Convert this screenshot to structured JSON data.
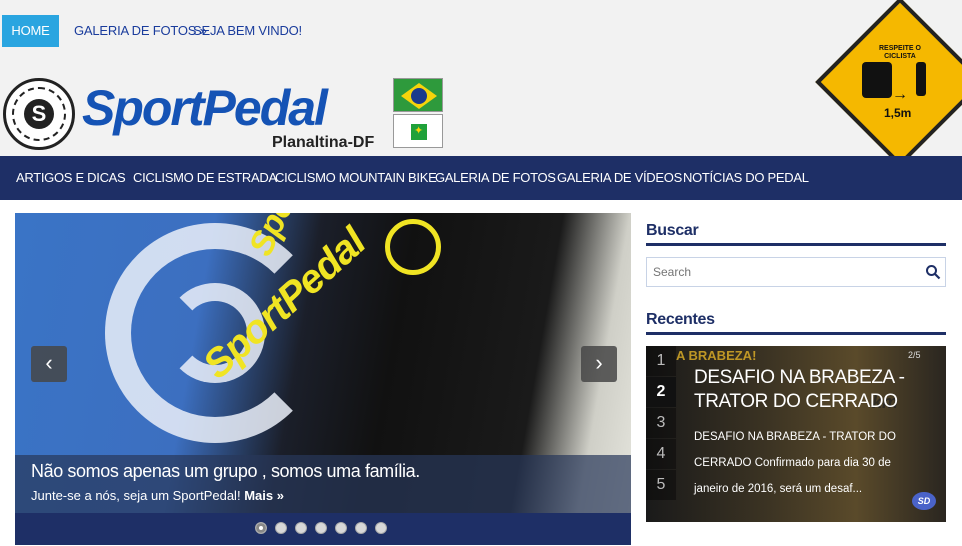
{
  "topnav": {
    "items": [
      "HOME",
      "GALERIA DE FOTOS »",
      "SEJA BEM VINDO!"
    ]
  },
  "header": {
    "logo_text": "SportPedal",
    "logo_sub": "Planaltina-DF",
    "sign_text": "RESPEITE O CICLISTA",
    "sign_distance": "1,5m"
  },
  "mainnav": {
    "items": [
      "ARTIGOS E DICAS",
      "CICLISMO DE ESTRADA",
      "CICLISMO MOUNTAIN BIKE",
      "GALERIA DE FOTOS",
      "GALERIA DE VÍDEOS",
      "NOTÍCIAS DO PEDAL"
    ]
  },
  "slider": {
    "jersey_text": "SportPedal",
    "caption_title": "Não somos apenas um grupo , somos uma família.",
    "caption_text": "Junte-se a nós, seja um SportPedal!",
    "caption_more": "Mais »",
    "prev_icon": "chevron-left-icon",
    "next_icon": "chevron-right-icon",
    "dots": 7,
    "active_dot": 1
  },
  "sidebar": {
    "search_title": "Buscar",
    "search_placeholder": "Search",
    "recent_title": "Recentes",
    "recent": {
      "numbers": [
        "1",
        "2",
        "3",
        "4",
        "5"
      ],
      "active": 2,
      "counter": "2/5",
      "banner": "A BRABEZA!",
      "title": "DESAFIO NA BRABEZA - TRATOR DO CERRADO",
      "text": "DESAFIO NA BRABEZA - TRATOR DO CERRADO Confirmado para dia 30 de janeiro de 2016, será um desaf...",
      "logo": "SD"
    }
  },
  "colors": {
    "nav_dark": "#1e2f66",
    "home_active": "#2aa5e0",
    "link_blue": "#1a3c9c",
    "jersey_yellow": "#f0e423"
  }
}
